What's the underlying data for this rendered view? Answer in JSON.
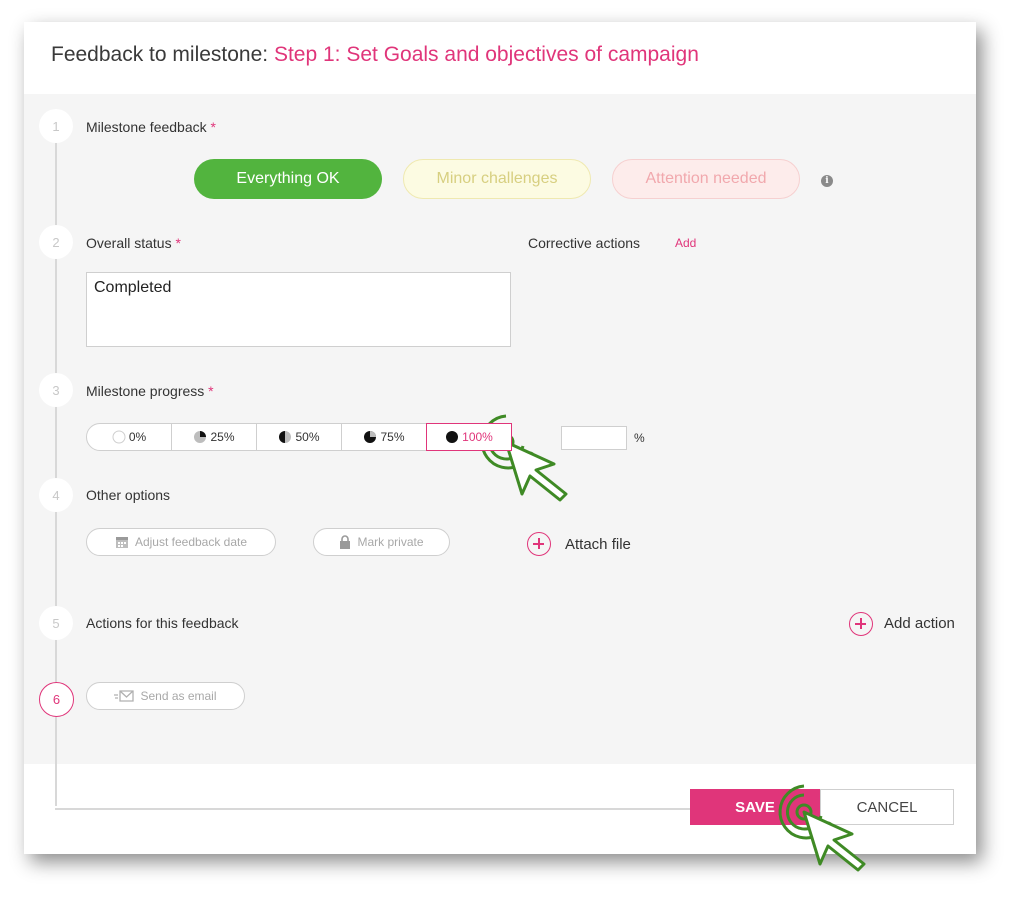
{
  "dialog": {
    "title_prefix": "Feedback to milestone: ",
    "title_milestone": "Step 1: Set Goals and objectives of campaign"
  },
  "steps": [
    "1",
    "2",
    "3",
    "4",
    "5",
    "6"
  ],
  "milestone_feedback": {
    "label": "Milestone feedback",
    "required_mark": "*",
    "options": [
      "Everything OK",
      "Minor challenges",
      "Attention needed"
    ],
    "selected": "Everything OK",
    "info_icon": "i"
  },
  "overall_status": {
    "label": "Overall status",
    "required_mark": "*",
    "value": "Completed"
  },
  "corrective_actions": {
    "label": "Corrective actions",
    "add_link": "Add"
  },
  "milestone_progress": {
    "label": "Milestone progress",
    "required_mark": "*",
    "options": [
      "0%",
      "25%",
      "50%",
      "75%",
      "100%"
    ],
    "selected": "100%",
    "custom_value": "",
    "unit": "%"
  },
  "other_options": {
    "label": "Other options",
    "adjust_date_label": "Adjust feedback date",
    "mark_private_label": "Mark private",
    "attach_file_label": "Attach file"
  },
  "actions_for_feedback": {
    "label": "Actions for this feedback",
    "add_action_label": "Add action"
  },
  "send_email": {
    "label": "Send as email"
  },
  "footer": {
    "save_label": "SAVE",
    "cancel_label": "CANCEL"
  },
  "colors": {
    "accent": "#e0357a",
    "ok_green": "#52b43e",
    "cursor_green": "#3f8a25"
  },
  "icons": [
    "info-icon",
    "calendar-icon",
    "lock-icon",
    "envelope-icon",
    "plus-circle-icon",
    "pointer-cursor-icon"
  ]
}
